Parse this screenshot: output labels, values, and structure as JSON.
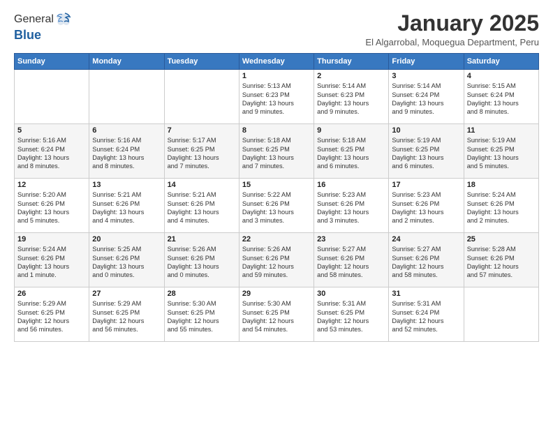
{
  "logo": {
    "general": "General",
    "blue": "Blue"
  },
  "header": {
    "month": "January 2025",
    "location": "El Algarrobal, Moquegua Department, Peru"
  },
  "weekdays": [
    "Sunday",
    "Monday",
    "Tuesday",
    "Wednesday",
    "Thursday",
    "Friday",
    "Saturday"
  ],
  "weeks": [
    [
      {
        "day": "",
        "info": ""
      },
      {
        "day": "",
        "info": ""
      },
      {
        "day": "",
        "info": ""
      },
      {
        "day": "1",
        "info": "Sunrise: 5:13 AM\nSunset: 6:23 PM\nDaylight: 13 hours\nand 9 minutes."
      },
      {
        "day": "2",
        "info": "Sunrise: 5:14 AM\nSunset: 6:23 PM\nDaylight: 13 hours\nand 9 minutes."
      },
      {
        "day": "3",
        "info": "Sunrise: 5:14 AM\nSunset: 6:24 PM\nDaylight: 13 hours\nand 9 minutes."
      },
      {
        "day": "4",
        "info": "Sunrise: 5:15 AM\nSunset: 6:24 PM\nDaylight: 13 hours\nand 8 minutes."
      }
    ],
    [
      {
        "day": "5",
        "info": "Sunrise: 5:16 AM\nSunset: 6:24 PM\nDaylight: 13 hours\nand 8 minutes."
      },
      {
        "day": "6",
        "info": "Sunrise: 5:16 AM\nSunset: 6:24 PM\nDaylight: 13 hours\nand 8 minutes."
      },
      {
        "day": "7",
        "info": "Sunrise: 5:17 AM\nSunset: 6:25 PM\nDaylight: 13 hours\nand 7 minutes."
      },
      {
        "day": "8",
        "info": "Sunrise: 5:18 AM\nSunset: 6:25 PM\nDaylight: 13 hours\nand 7 minutes."
      },
      {
        "day": "9",
        "info": "Sunrise: 5:18 AM\nSunset: 6:25 PM\nDaylight: 13 hours\nand 6 minutes."
      },
      {
        "day": "10",
        "info": "Sunrise: 5:19 AM\nSunset: 6:25 PM\nDaylight: 13 hours\nand 6 minutes."
      },
      {
        "day": "11",
        "info": "Sunrise: 5:19 AM\nSunset: 6:25 PM\nDaylight: 13 hours\nand 5 minutes."
      }
    ],
    [
      {
        "day": "12",
        "info": "Sunrise: 5:20 AM\nSunset: 6:26 PM\nDaylight: 13 hours\nand 5 minutes."
      },
      {
        "day": "13",
        "info": "Sunrise: 5:21 AM\nSunset: 6:26 PM\nDaylight: 13 hours\nand 4 minutes."
      },
      {
        "day": "14",
        "info": "Sunrise: 5:21 AM\nSunset: 6:26 PM\nDaylight: 13 hours\nand 4 minutes."
      },
      {
        "day": "15",
        "info": "Sunrise: 5:22 AM\nSunset: 6:26 PM\nDaylight: 13 hours\nand 3 minutes."
      },
      {
        "day": "16",
        "info": "Sunrise: 5:23 AM\nSunset: 6:26 PM\nDaylight: 13 hours\nand 3 minutes."
      },
      {
        "day": "17",
        "info": "Sunrise: 5:23 AM\nSunset: 6:26 PM\nDaylight: 13 hours\nand 2 minutes."
      },
      {
        "day": "18",
        "info": "Sunrise: 5:24 AM\nSunset: 6:26 PM\nDaylight: 13 hours\nand 2 minutes."
      }
    ],
    [
      {
        "day": "19",
        "info": "Sunrise: 5:24 AM\nSunset: 6:26 PM\nDaylight: 13 hours\nand 1 minute."
      },
      {
        "day": "20",
        "info": "Sunrise: 5:25 AM\nSunset: 6:26 PM\nDaylight: 13 hours\nand 0 minutes."
      },
      {
        "day": "21",
        "info": "Sunrise: 5:26 AM\nSunset: 6:26 PM\nDaylight: 13 hours\nand 0 minutes."
      },
      {
        "day": "22",
        "info": "Sunrise: 5:26 AM\nSunset: 6:26 PM\nDaylight: 12 hours\nand 59 minutes."
      },
      {
        "day": "23",
        "info": "Sunrise: 5:27 AM\nSunset: 6:26 PM\nDaylight: 12 hours\nand 58 minutes."
      },
      {
        "day": "24",
        "info": "Sunrise: 5:27 AM\nSunset: 6:26 PM\nDaylight: 12 hours\nand 58 minutes."
      },
      {
        "day": "25",
        "info": "Sunrise: 5:28 AM\nSunset: 6:26 PM\nDaylight: 12 hours\nand 57 minutes."
      }
    ],
    [
      {
        "day": "26",
        "info": "Sunrise: 5:29 AM\nSunset: 6:25 PM\nDaylight: 12 hours\nand 56 minutes."
      },
      {
        "day": "27",
        "info": "Sunrise: 5:29 AM\nSunset: 6:25 PM\nDaylight: 12 hours\nand 56 minutes."
      },
      {
        "day": "28",
        "info": "Sunrise: 5:30 AM\nSunset: 6:25 PM\nDaylight: 12 hours\nand 55 minutes."
      },
      {
        "day": "29",
        "info": "Sunrise: 5:30 AM\nSunset: 6:25 PM\nDaylight: 12 hours\nand 54 minutes."
      },
      {
        "day": "30",
        "info": "Sunrise: 5:31 AM\nSunset: 6:25 PM\nDaylight: 12 hours\nand 53 minutes."
      },
      {
        "day": "31",
        "info": "Sunrise: 5:31 AM\nSunset: 6:24 PM\nDaylight: 12 hours\nand 52 minutes."
      },
      {
        "day": "",
        "info": ""
      }
    ]
  ]
}
